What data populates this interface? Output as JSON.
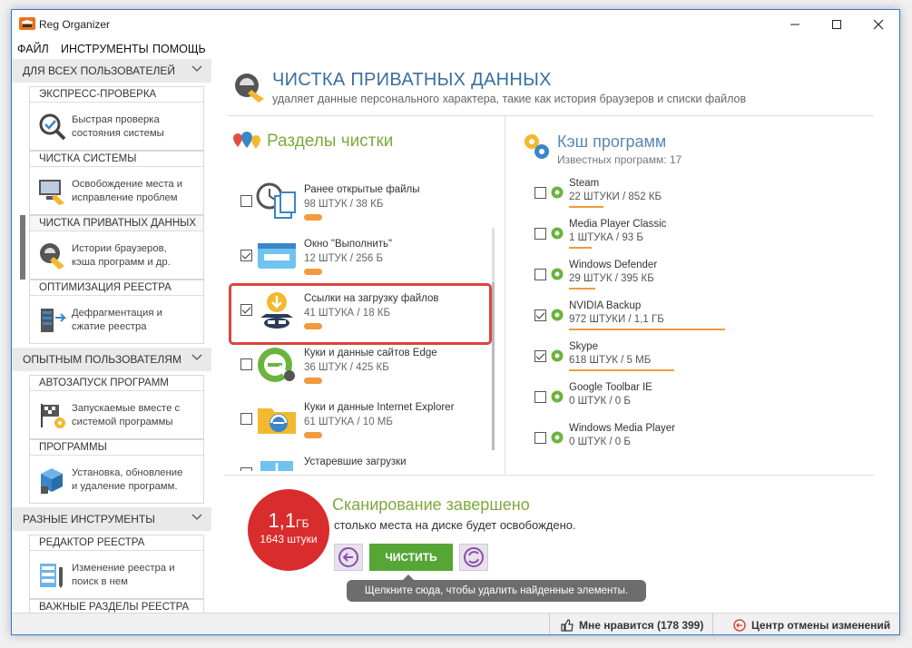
{
  "window": {
    "title": "Reg Organizer"
  },
  "menu": [
    "ФАЙЛ",
    "ИНСТРУМЕНТЫ",
    "ПОМОЩЬ"
  ],
  "sidebar": {
    "sections": [
      {
        "title": "ДЛЯ ВСЕХ ПОЛЬЗОВАТЕЛЕЙ"
      },
      {
        "title": "ОПЫТНЫМ ПОЛЬЗОВАТЕЛЯМ"
      },
      {
        "title": "РАЗНЫЕ ИНСТРУМЕНТЫ"
      }
    ],
    "items": [
      {
        "title": "ЭКСПРЕСС-ПРОВЕРКА",
        "desc1": "Быстрая проверка",
        "desc2": "состояния системы"
      },
      {
        "title": "ЧИСТКА СИСТЕМЫ",
        "desc1": "Освобождение места и",
        "desc2": "исправление проблем"
      },
      {
        "title": "ЧИСТКА ПРИВАТНЫХ ДАННЫХ",
        "desc1": "Истории браузеров,",
        "desc2": "кэша программ и др."
      },
      {
        "title": "ОПТИМИЗАЦИЯ РЕЕСТРА",
        "desc1": "Дефрагментация и",
        "desc2": "сжатие реестра"
      },
      {
        "title": "АВТОЗАПУСК ПРОГРАММ",
        "desc1": "Запускаемые вместе с",
        "desc2": "системой программы"
      },
      {
        "title": "ПРОГРАММЫ",
        "desc1": "Установка, обновление",
        "desc2": "и удаление программ."
      },
      {
        "title": "РЕДАКТОР РЕЕСТРА",
        "desc1": "Изменение реестра и",
        "desc2": "поиск в нем"
      },
      {
        "title": "ВАЖНЫЕ РАЗДЕЛЫ РЕЕСТРА"
      }
    ]
  },
  "header": {
    "title": "ЧИСТКА ПРИВАТНЫХ ДАННЫХ",
    "subtitle": "удаляет данные персонального характера, такие как история браузеров и списки файлов"
  },
  "sections_panel": {
    "title": "Разделы чистки",
    "items": [
      {
        "name": "Ранее открытые файлы",
        "count": "98 ШТУК / 38 КБ",
        "checked": false
      },
      {
        "name": "Окно \"Выполнить\"",
        "count": "12 ШТУК / 256 Б",
        "checked": true
      },
      {
        "name": "Ссылки на загрузку файлов",
        "count": "41 ШТУКА / 18 КБ",
        "checked": true
      },
      {
        "name": "Куки и данные сайтов Edge",
        "count": "36 ШТУК / 425 КБ",
        "checked": false
      },
      {
        "name": "Куки и данные Internet Explorer",
        "count": "61 ШТУКА / 10 МБ",
        "checked": false
      },
      {
        "name": "Устаревшие загрузки",
        "checked": false
      }
    ]
  },
  "cache_panel": {
    "title": "Кэш программ",
    "subtitle": "Известных программ: 17",
    "items": [
      {
        "name": "Steam",
        "count": "22 ШТУКИ / 852 КБ",
        "checked": false,
        "bar": 0.18
      },
      {
        "name": "Media Player Classic",
        "count": "1 ШТУКА / 93 Б",
        "checked": false,
        "bar": 0.12
      },
      {
        "name": "Windows Defender",
        "count": "29 ШТУК / 395 КБ",
        "checked": false,
        "bar": 0.14
      },
      {
        "name": "NVIDIA Backup",
        "count": "972 ШТУКИ / 1,1 ГБ",
        "checked": true,
        "bar": 0.82
      },
      {
        "name": "Skype",
        "count": "618 ШТУК / 5 МБ",
        "checked": true,
        "bar": 0.55
      },
      {
        "name": "Google Toolbar IE",
        "count": "0 ШТУК / 0 Б",
        "checked": false,
        "bar": 0
      },
      {
        "name": "Windows Media Player",
        "count": "0 ШТУК / 0 Б",
        "checked": false,
        "bar": 0
      }
    ]
  },
  "scan": {
    "size": "1,1",
    "size_unit": "ГБ",
    "count": "1643 штуки",
    "title": "Сканирование завершено",
    "subtitle": "столько места на диске будет освобождено.",
    "clean_button": "ЧИСТИТЬ",
    "tooltip": "Щелкните сюда, чтобы удалить найденные элементы."
  },
  "status": {
    "like": "Мне нравится (178 399)",
    "undo": "Центр отмены изменений"
  },
  "colors": {
    "accent": "#3a6e9e",
    "green": "#7fa83c",
    "orange": "#f29a3c",
    "red": "#d92c2c"
  }
}
